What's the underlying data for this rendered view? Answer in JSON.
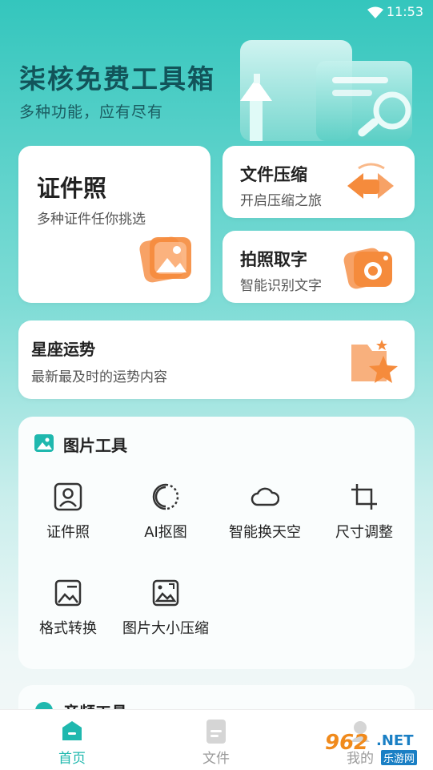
{
  "status_bar": {
    "time": "11:53"
  },
  "hero": {
    "title": "柒核免费工具箱",
    "subtitle": "多种功能，应有尽有"
  },
  "cards": {
    "id_photo": {
      "title": "证件照",
      "subtitle": "多种证件任你挑选"
    },
    "compress": {
      "title": "文件压缩",
      "subtitle": "开启压缩之旅"
    },
    "ocr": {
      "title": "拍照取字",
      "subtitle": "智能识别文字"
    },
    "horoscope": {
      "title": "星座运势",
      "subtitle": "最新最及时的运势内容"
    }
  },
  "image_tools": {
    "heading": "图片工具",
    "items": [
      {
        "label": "证件照",
        "icon": "portrait-icon"
      },
      {
        "label": "AI抠图",
        "icon": "cutout-icon"
      },
      {
        "label": "智能换天空",
        "icon": "cloud-icon"
      },
      {
        "label": "尺寸调整",
        "icon": "crop-icon"
      },
      {
        "label": "格式转换",
        "icon": "image-convert-icon"
      },
      {
        "label": "图片大小压缩",
        "icon": "image-compress-icon"
      }
    ]
  },
  "audio_tools": {
    "heading": "音频工具"
  },
  "tabs": [
    {
      "label": "首页",
      "icon": "home-icon",
      "active": true
    },
    {
      "label": "文件",
      "icon": "file-icon",
      "active": false
    },
    {
      "label": "我的",
      "icon": "user-icon",
      "active": false
    }
  ],
  "watermark": {
    "number": "962",
    "domain": ".NET",
    "site": "乐游网"
  },
  "colors": {
    "accent": "#1fb8ae",
    "title": "#12545a",
    "orange": "#f58b3c"
  }
}
